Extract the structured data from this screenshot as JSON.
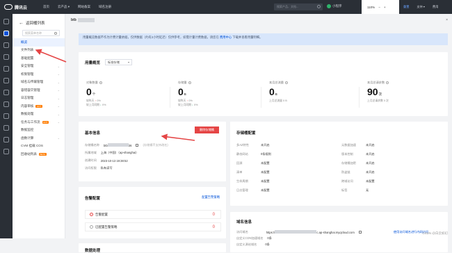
{
  "topbar": {
    "brand": "腾讯云",
    "nav": [
      "首页",
      "云产品 ▾",
      "网站备案",
      "域名注册"
    ],
    "search_placeholder": "搜索产品、文档...",
    "mini_app": "小程序",
    "zoom": "110%",
    "zoom_minus": "−",
    "zoom_plus": "+",
    "zoom_reset": "重置",
    "right_nav": [
      "备案",
      "支持 ▾",
      "费用"
    ]
  },
  "sidebar": {
    "back_label": "返回桶列表",
    "search_placeholder": "搜索菜单名称",
    "items": [
      {
        "label": "概览",
        "active": true
      },
      {
        "label": "文件列表"
      },
      {
        "label": "基础配置",
        "chevron": true
      },
      {
        "label": "安全管理",
        "chevron": true
      },
      {
        "label": "权限管理",
        "chevron": true
      },
      {
        "label": "域名与传输管理",
        "chevron": true
      },
      {
        "label": "容错容灾管理",
        "chevron": true
      },
      {
        "label": "日志管理",
        "chevron": true
      },
      {
        "label": "内容审核",
        "badge": "HOT",
        "chevron": true
      },
      {
        "label": "数据处理",
        "chevron": true
      },
      {
        "label": "任务与工作流",
        "badge": "HOT",
        "chevron": true
      },
      {
        "label": "数据监控"
      },
      {
        "label": "函数计算",
        "chevron": true
      },
      {
        "label": "CVM 挂载 COS"
      },
      {
        "label": "回收站列表",
        "badge": "BETA"
      }
    ]
  },
  "header": {
    "bucket_prefix": "btb",
    "close": "×"
  },
  "notice": {
    "text": "用量概览数据不作为计费计量依据，仅供数据（约有2小时延迟）仅供参考，如需计量计费数据，请您在",
    "link": "费用中心",
    "suffix": "下载并查看用量明细。"
  },
  "usage": {
    "title": "用量概览",
    "select_value": "标准存储",
    "metrics": [
      {
        "label": "对象数量",
        "value": "0",
        "unit": "个",
        "sub1_label": "较昨天",
        "sub1_dir": "up",
        "sub1_val": "0%",
        "sub2_label": "较上月同期",
        "sub2_dir": "down",
        "sub2_val": "0%"
      },
      {
        "label": "存储量",
        "value": "0",
        "unit": "B",
        "sub1_label": "较昨天",
        "sub1_dir": "up",
        "sub1_val": "0%",
        "sub2_label": "较上月同期",
        "sub2_dir": "down",
        "sub2_val": "0%"
      },
      {
        "label": "本月总流量",
        "value": "0",
        "unit": "B",
        "sub1_label": "上月总流量",
        "sub1_val": "0 B"
      },
      {
        "label": "本月总请求数",
        "value": "90",
        "unit": "次",
        "sub1_label": "上月总请求数",
        "sub1_val": "0 次"
      }
    ]
  },
  "basic": {
    "title": "基本信息",
    "delete_label": "删除存储桶",
    "rows": [
      {
        "k": "存储桶名称",
        "v_prefix": "btb",
        "v_suffix": "36",
        "hint": "(存储桶不支持改名)"
      },
      {
        "k": "所属地域",
        "v": "上海（中国）（ap-shanghai）"
      },
      {
        "k": "创建时间",
        "v": "2023-10-13 19:38:52"
      },
      {
        "k": "访问权限",
        "v": "私有读写"
      }
    ]
  },
  "storage_cfg": {
    "title": "存储桶配置",
    "left": [
      {
        "k": "多AZ特性",
        "v": "未开启"
      },
      {
        "k": "静态网站",
        "v": "0条规则"
      },
      {
        "k": "回源",
        "v": "未配置"
      },
      {
        "k": "清单",
        "v": "未配置"
      },
      {
        "k": "生命周期",
        "v": "未配置"
      },
      {
        "k": "日志管理",
        "v": "未配置"
      }
    ],
    "right": [
      {
        "k": "元数据加速",
        "v": "未开启"
      },
      {
        "k": "版本控制",
        "v": "未开启"
      },
      {
        "k": "存储桶加密",
        "v": "未开启"
      },
      {
        "k": "防盗链",
        "v": "未开启"
      },
      {
        "k": "跨域访问",
        "v": "未配置"
      },
      {
        "k": "标签",
        "v": "无"
      }
    ]
  },
  "alert": {
    "title": "告警配置",
    "link": "配置告警策略",
    "rows": [
      {
        "label": "告警配置",
        "count": "0"
      },
      {
        "label": "已配置告警策略",
        "count": "0"
      }
    ]
  },
  "domain": {
    "title": "域名信息",
    "rows": [
      {
        "k": "访问域名",
        "v_prefix": "https://",
        "v_suffix": "c.ap-shanghai.myqcloud.com",
        "link": "使用访问域名进行内网访问"
      },
      {
        "k": "自定义CDN加速域名",
        "v": "0条"
      },
      {
        "k": "自定义源站域名",
        "v": "0条"
      }
    ]
  },
  "extra": {
    "title": "数据处理"
  },
  "watermark": "CSDN @白云如幻",
  "colors": {
    "brand": "#0052d9",
    "danger": "#e54545",
    "arrow": "#e54545"
  }
}
